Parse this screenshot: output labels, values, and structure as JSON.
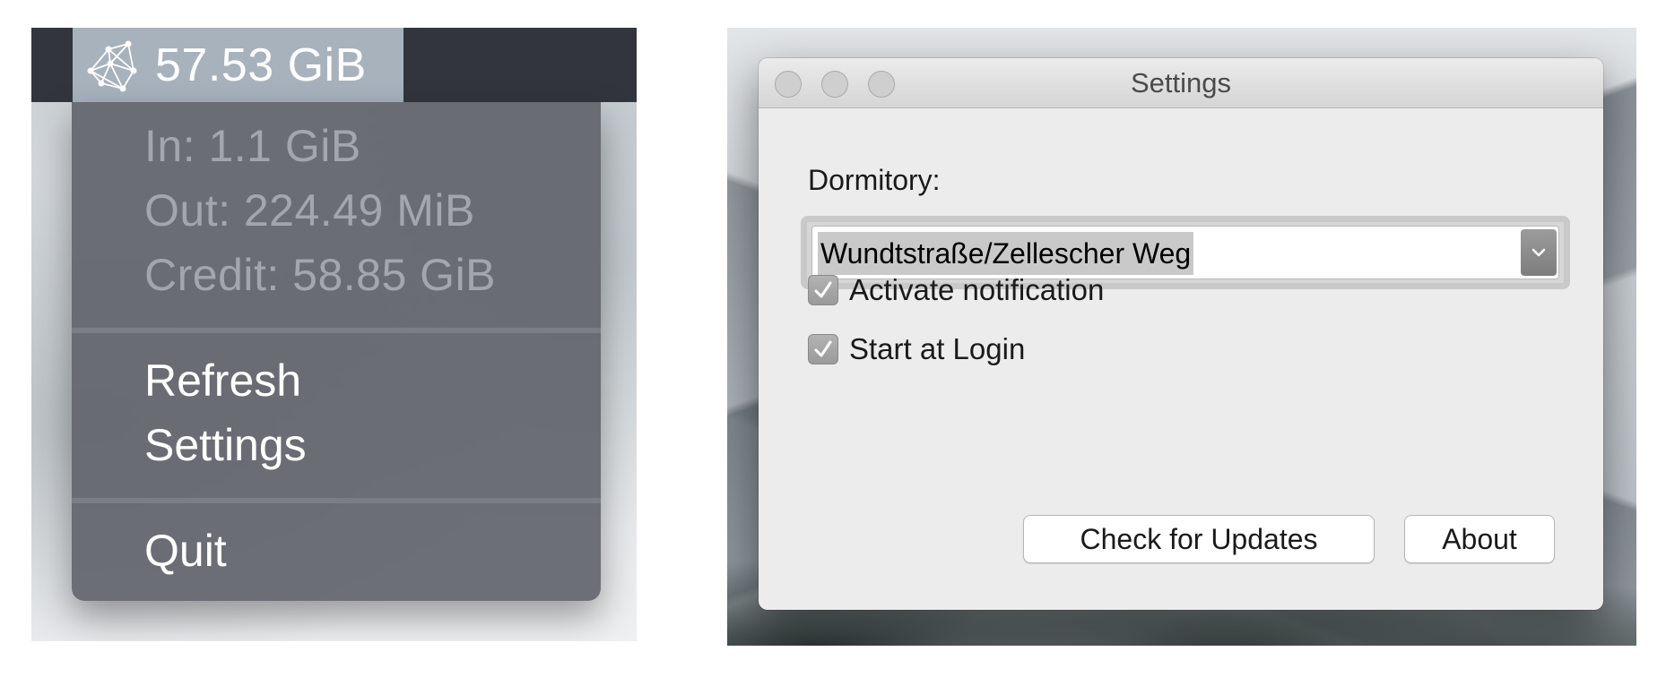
{
  "menubar_extra": {
    "status_value": "57.53 GiB",
    "icon": "network-graph-icon",
    "stats": {
      "in": "In: 1.1 GiB",
      "out": "Out: 224.49 MiB",
      "credit": "Credit: 58.85 GiB"
    },
    "menu_items": {
      "refresh": "Refresh",
      "settings": "Settings",
      "quit": "Quit"
    }
  },
  "settings_window": {
    "title": "Settings",
    "traffic_lights": [
      "close-icon",
      "minimize-icon",
      "zoom-icon"
    ],
    "dormitory": {
      "label": "Dormitory:",
      "selected": "Wundtstraße/Zellescher Weg",
      "arrow_icon": "chevron-down-icon"
    },
    "options": [
      {
        "label": "Activate notification",
        "checked": true
      },
      {
        "label": "Start at Login",
        "checked": true
      }
    ],
    "buttons": {
      "check_updates": "Check for Updates",
      "about": "About"
    }
  },
  "colors": {
    "menubar": "#32353d",
    "status_highlight": "#a7b2bd",
    "dropdown": "#62656c",
    "window_bg": "#ececec"
  }
}
